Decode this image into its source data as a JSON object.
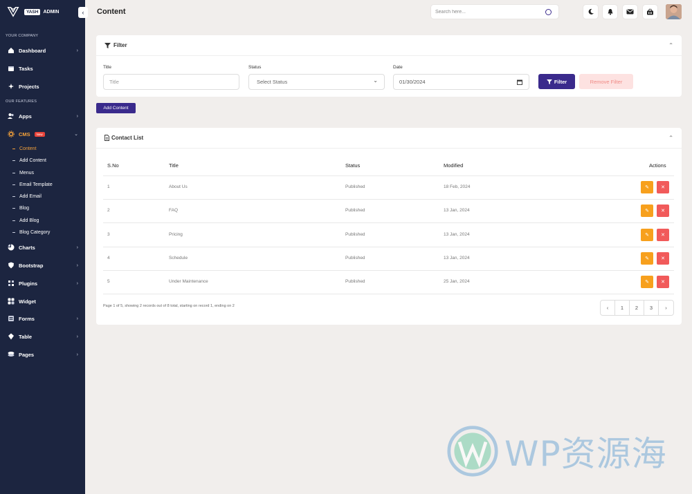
{
  "brand": {
    "tag": "YASH",
    "name": "ADMIN"
  },
  "sidebar": {
    "sections": [
      "YOUR COMPANY",
      "OUR FEATURES"
    ],
    "items": [
      {
        "label": "Dashboard",
        "icon": "home-icon"
      },
      {
        "label": "Tasks",
        "icon": "calendar-icon"
      },
      {
        "label": "Projects",
        "icon": "projects-icon"
      },
      {
        "label": "Apps",
        "icon": "users-icon"
      },
      {
        "label": "CMS",
        "icon": "gear-icon",
        "badge": "New"
      },
      {
        "label": "Charts",
        "icon": "chart-icon"
      },
      {
        "label": "Bootstrap",
        "icon": "shield-icon"
      },
      {
        "label": "Plugins",
        "icon": "plugins-icon"
      },
      {
        "label": "Widget",
        "icon": "widget-icon"
      },
      {
        "label": "Forms",
        "icon": "forms-icon"
      },
      {
        "label": "Table",
        "icon": "table-icon"
      },
      {
        "label": "Pages",
        "icon": "layers-icon"
      }
    ],
    "cms_sub": [
      "Content",
      "Add Content",
      "Menus",
      "Email Template",
      "Add Email",
      "Blog",
      "Add Blog",
      "Blog Category"
    ]
  },
  "header": {
    "title": "Content",
    "search_placeholder": "Search here..."
  },
  "filter": {
    "title": "Filter",
    "labels": {
      "title": "Title",
      "status": "Status",
      "date": "Date"
    },
    "title_placeholder": "Title",
    "status_value": "Select Status",
    "date_value": "01/30/2024",
    "filter_btn": "Filter",
    "remove_btn": "Remove Filter"
  },
  "add_content": "Add Content",
  "list": {
    "title": "Contact List",
    "headers": [
      "S.No",
      "Title",
      "Status",
      "Modified",
      "Actions"
    ],
    "rows": [
      {
        "no": "1",
        "title": "About Us",
        "status": "Published",
        "modified": "18 Feb, 2024"
      },
      {
        "no": "2",
        "title": "FAQ",
        "status": "Published",
        "modified": "13 Jan, 2024"
      },
      {
        "no": "3",
        "title": "Pricing",
        "status": "Published",
        "modified": "13 Jan, 2024"
      },
      {
        "no": "4",
        "title": "Schedule",
        "status": "Published",
        "modified": "13 Jan, 2024"
      },
      {
        "no": "5",
        "title": "Under Maintenance",
        "status": "Published",
        "modified": "25 Jan, 2024"
      }
    ],
    "page_info": "Page 1 of 5, showing 2 records out of 8 total, starting on record 1, ending on 2",
    "pages": [
      "1",
      "2",
      "3"
    ]
  },
  "watermark": "WP资源海",
  "colors": {
    "sidebar": "#1c2540",
    "accent": "#3a2a8c",
    "active": "#f6a23a",
    "edit": "#f7a01d",
    "delete": "#f15a5a"
  }
}
